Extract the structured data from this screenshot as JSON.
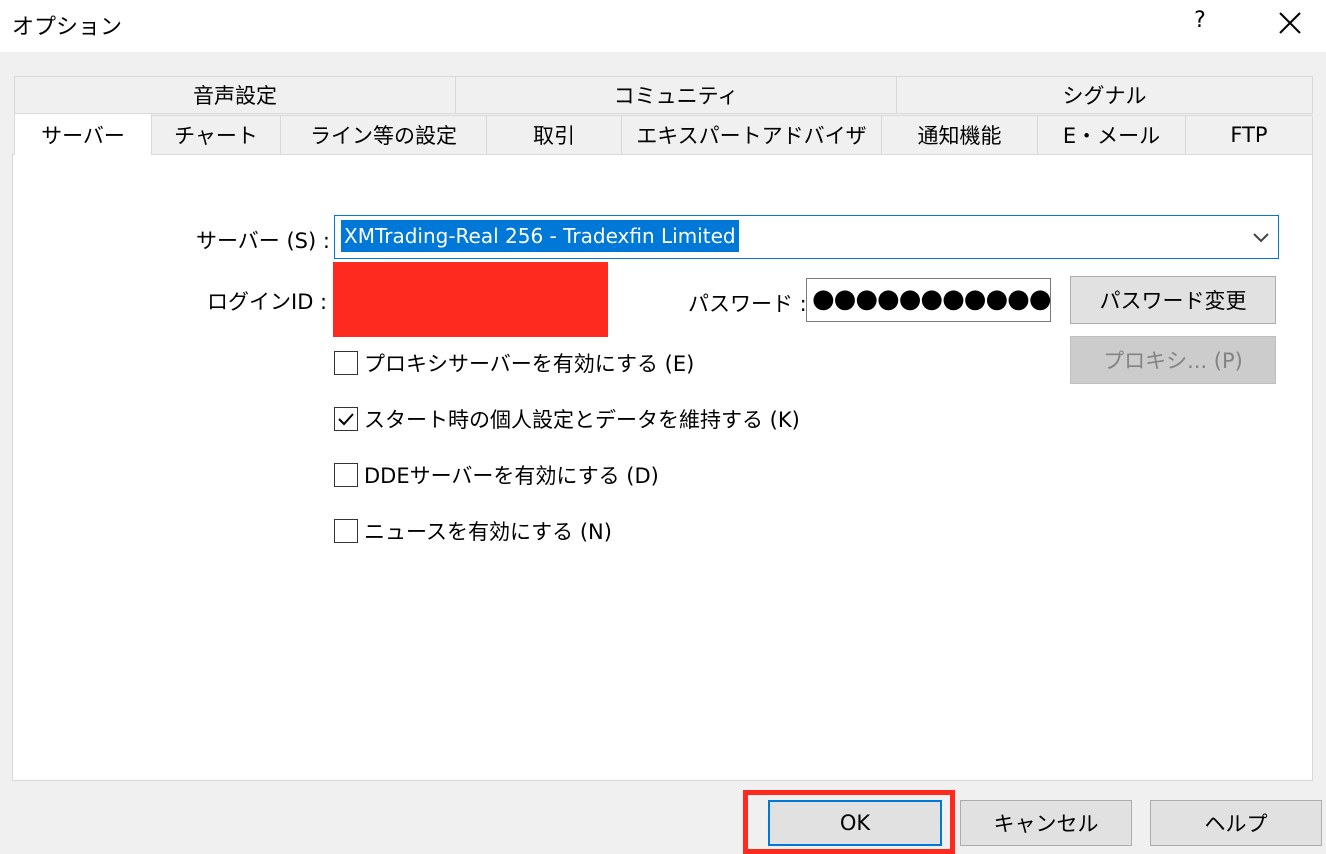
{
  "window": {
    "title": "オプション",
    "help_label": "?",
    "close_icon": "close-icon"
  },
  "tabs": {
    "row_back": [
      "音声設定",
      "コミュニティ",
      "シグナル"
    ],
    "row_front": [
      "サーバー",
      "チャート",
      "ライン等の設定",
      "取引",
      "エキスパートアドバイザ",
      "通知機能",
      "E・メール",
      "FTP"
    ],
    "active": "サーバー"
  },
  "server": {
    "label": "サーバー (S) :",
    "value": "XMTrading-Real 256 - Tradexfin Limited"
  },
  "login": {
    "label": "ログインID :"
  },
  "password": {
    "label": "パスワード :",
    "masked_value": "●●●●●●●●●●●",
    "change_label": "パスワード変更",
    "proxy_label": "プロキシ... (P)"
  },
  "checkboxes": [
    {
      "label": "プロキシサーバーを有効にする (E)",
      "checked": false
    },
    {
      "label": "スタート時の個人設定とデータを維持する (K)",
      "checked": true
    },
    {
      "label": "DDEサーバーを有効にする (D)",
      "checked": false
    },
    {
      "label": "ニュースを有効にする (N)",
      "checked": false
    }
  ],
  "footer": {
    "ok_label": "OK",
    "cancel_label": "キャンセル",
    "help_label": "ヘルプ"
  },
  "colors": {
    "accent": "#0078d7",
    "highlight": "#ff2a1f"
  }
}
